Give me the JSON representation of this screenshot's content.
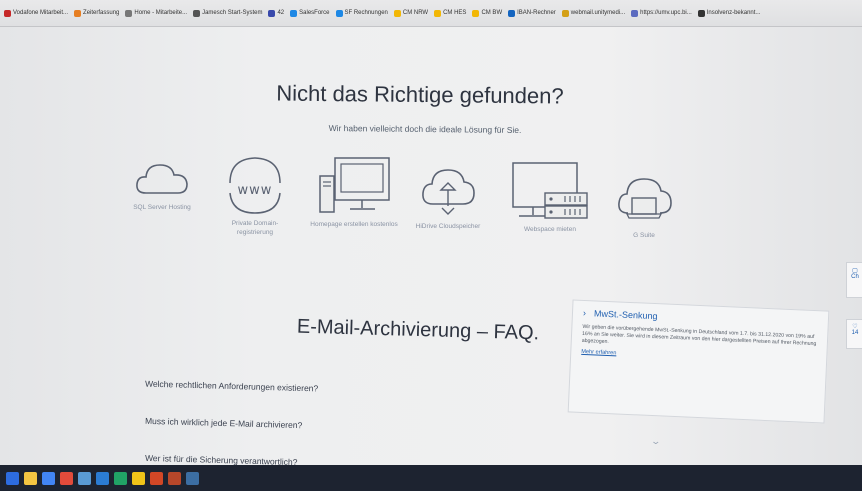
{
  "bookmarks": [
    {
      "label": "Vodafone Mitarbeit...",
      "color": "#c62828"
    },
    {
      "label": "Zeiterfassung",
      "color": "#e67e22"
    },
    {
      "label": "Home - Mitarbeite...",
      "color": "#777777"
    },
    {
      "label": "Jamesch Start-System",
      "color": "#555555"
    },
    {
      "label": "42",
      "color": "#3949ab"
    },
    {
      "label": "SalesForce",
      "color": "#1e88e5"
    },
    {
      "label": "SF Rechnungen",
      "color": "#1e88e5"
    },
    {
      "label": "CM NRW",
      "color": "#f2b705"
    },
    {
      "label": "CM HES",
      "color": "#f2b705"
    },
    {
      "label": "CM BW",
      "color": "#f2b705"
    },
    {
      "label": "IBAN-Rechner",
      "color": "#1565c0"
    },
    {
      "label": "webmail.unitymedi...",
      "color": "#d4a017"
    },
    {
      "label": "https://umv.upc.bi...",
      "color": "#5c6bc0"
    },
    {
      "label": "Insolvenz-bekannt...",
      "color": "#333333"
    }
  ],
  "hero": {
    "title": "Nicht das Richtige gefunden?",
    "subtitle": "Wir haben vielleicht doch die ideale Lösung für Sie."
  },
  "products": [
    {
      "label": "SQL Server Hosting",
      "icon": "cloud-icon"
    },
    {
      "label": "Private Domain-registrierung",
      "icon": "www-globe-icon"
    },
    {
      "label": "Homepage erstellen kostenlos",
      "icon": "desktop-tower-icon"
    },
    {
      "label": "HiDrive Cloudspeicher",
      "icon": "cloud-sync-icon"
    },
    {
      "label": "Webspace mieten",
      "icon": "monitor-server-icon"
    },
    {
      "label": "G Suite",
      "icon": "cloud-laptop-icon"
    }
  ],
  "faq": {
    "title": "E-Mail-Archivierung – FAQ.",
    "questions": [
      "Welche rechtlichen Anforderungen existieren?",
      "Muss ich wirklich jede E-Mail archivieren?",
      "Wer ist für die Sicherung verantwortlich?"
    ]
  },
  "tax_notice": {
    "title": "MwSt.-Senkung",
    "text": "Wir geben die vorübergehende MwSt.-Senkung in Deutschland vom 1.7. bis 31.12.2020 von 19% auf 16% an Sie weiter. Sie wird in diesem Zeitraum von den hier dargestellten Preisen auf Ihrer Rechnung abgezogen.",
    "link": "Mehr erfahren"
  },
  "side_widgets": [
    "Ch",
    "14"
  ],
  "colors": {
    "accent": "#1f5fb0",
    "icon_stroke": "#5a6272",
    "text_dark": "#2e3440"
  }
}
